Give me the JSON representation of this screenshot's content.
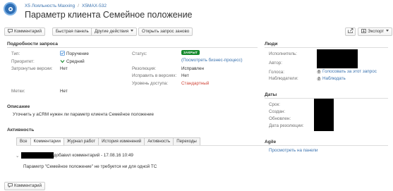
{
  "header": {
    "project": "X5 Лояльность Maxxing",
    "issue_key": "X5MAX-532",
    "title": "Параметр клиента Семейное положение"
  },
  "toolbar": {
    "comment": "Комментарий",
    "quick_panel": "Быстрая панель",
    "other_actions": "Другие действия",
    "reopen": "Открыть запрос заново",
    "export": "Экспорт"
  },
  "details": {
    "heading": "Подробности запроса",
    "type_label": "Тип:",
    "type_value": "Поручение",
    "priority_label": "Приоритет:",
    "priority_value": "Средний",
    "versions_label": "Затронутые версии:",
    "versions_value": "Нет",
    "labels_label": "Метки:",
    "labels_value": "Нет",
    "status_label": "Статус:",
    "status_value": "ЗАКРЫТ",
    "workflow_link": "(Посмотреть бизнес-процесс)",
    "resolution_label": "Резолюция:",
    "resolution_value": "Исправлен",
    "fix_label": "Исправить в версиях:",
    "fix_value": "Нет",
    "security_label": "Уровень доступа:",
    "security_value": "Стандартный"
  },
  "description": {
    "heading": "Описание",
    "text": "Уточнить у aCRM нужен ли параметр клиента Семейное положение"
  },
  "activity": {
    "heading": "Активность",
    "tabs": [
      "Все",
      "Комментарии",
      "Журнал работ",
      "История изменений",
      "Активность",
      "Переходы"
    ],
    "comment_meta": "добавил комментарий - 17.08.16 10:49",
    "comment_text": "Параметр \"Семейное положение\" не требуется ни для одной ТС",
    "comment_button": "Комментарий"
  },
  "people": {
    "heading": "Люди",
    "assignee_label": "Исполнитель:",
    "reporter_label": "Автор:",
    "votes_label": "Голоса:",
    "votes_count": "0",
    "votes_link": "Голосовать за этот запрос",
    "watchers_label": "Наблюдатели:",
    "watchers_count": "2",
    "watchers_link": "Наблюдать"
  },
  "dates": {
    "heading": "Даты",
    "due_label": "Срок:",
    "created_label": "Создан:",
    "updated_label": "Обновлен:",
    "resolved_label": "Дата резолюции:"
  },
  "agile": {
    "heading": "Agile",
    "link": "Просмотреть на панели"
  },
  "colors": {
    "link": "#3b73af",
    "status_closed": "#14892c",
    "security_red": "#d04437"
  }
}
